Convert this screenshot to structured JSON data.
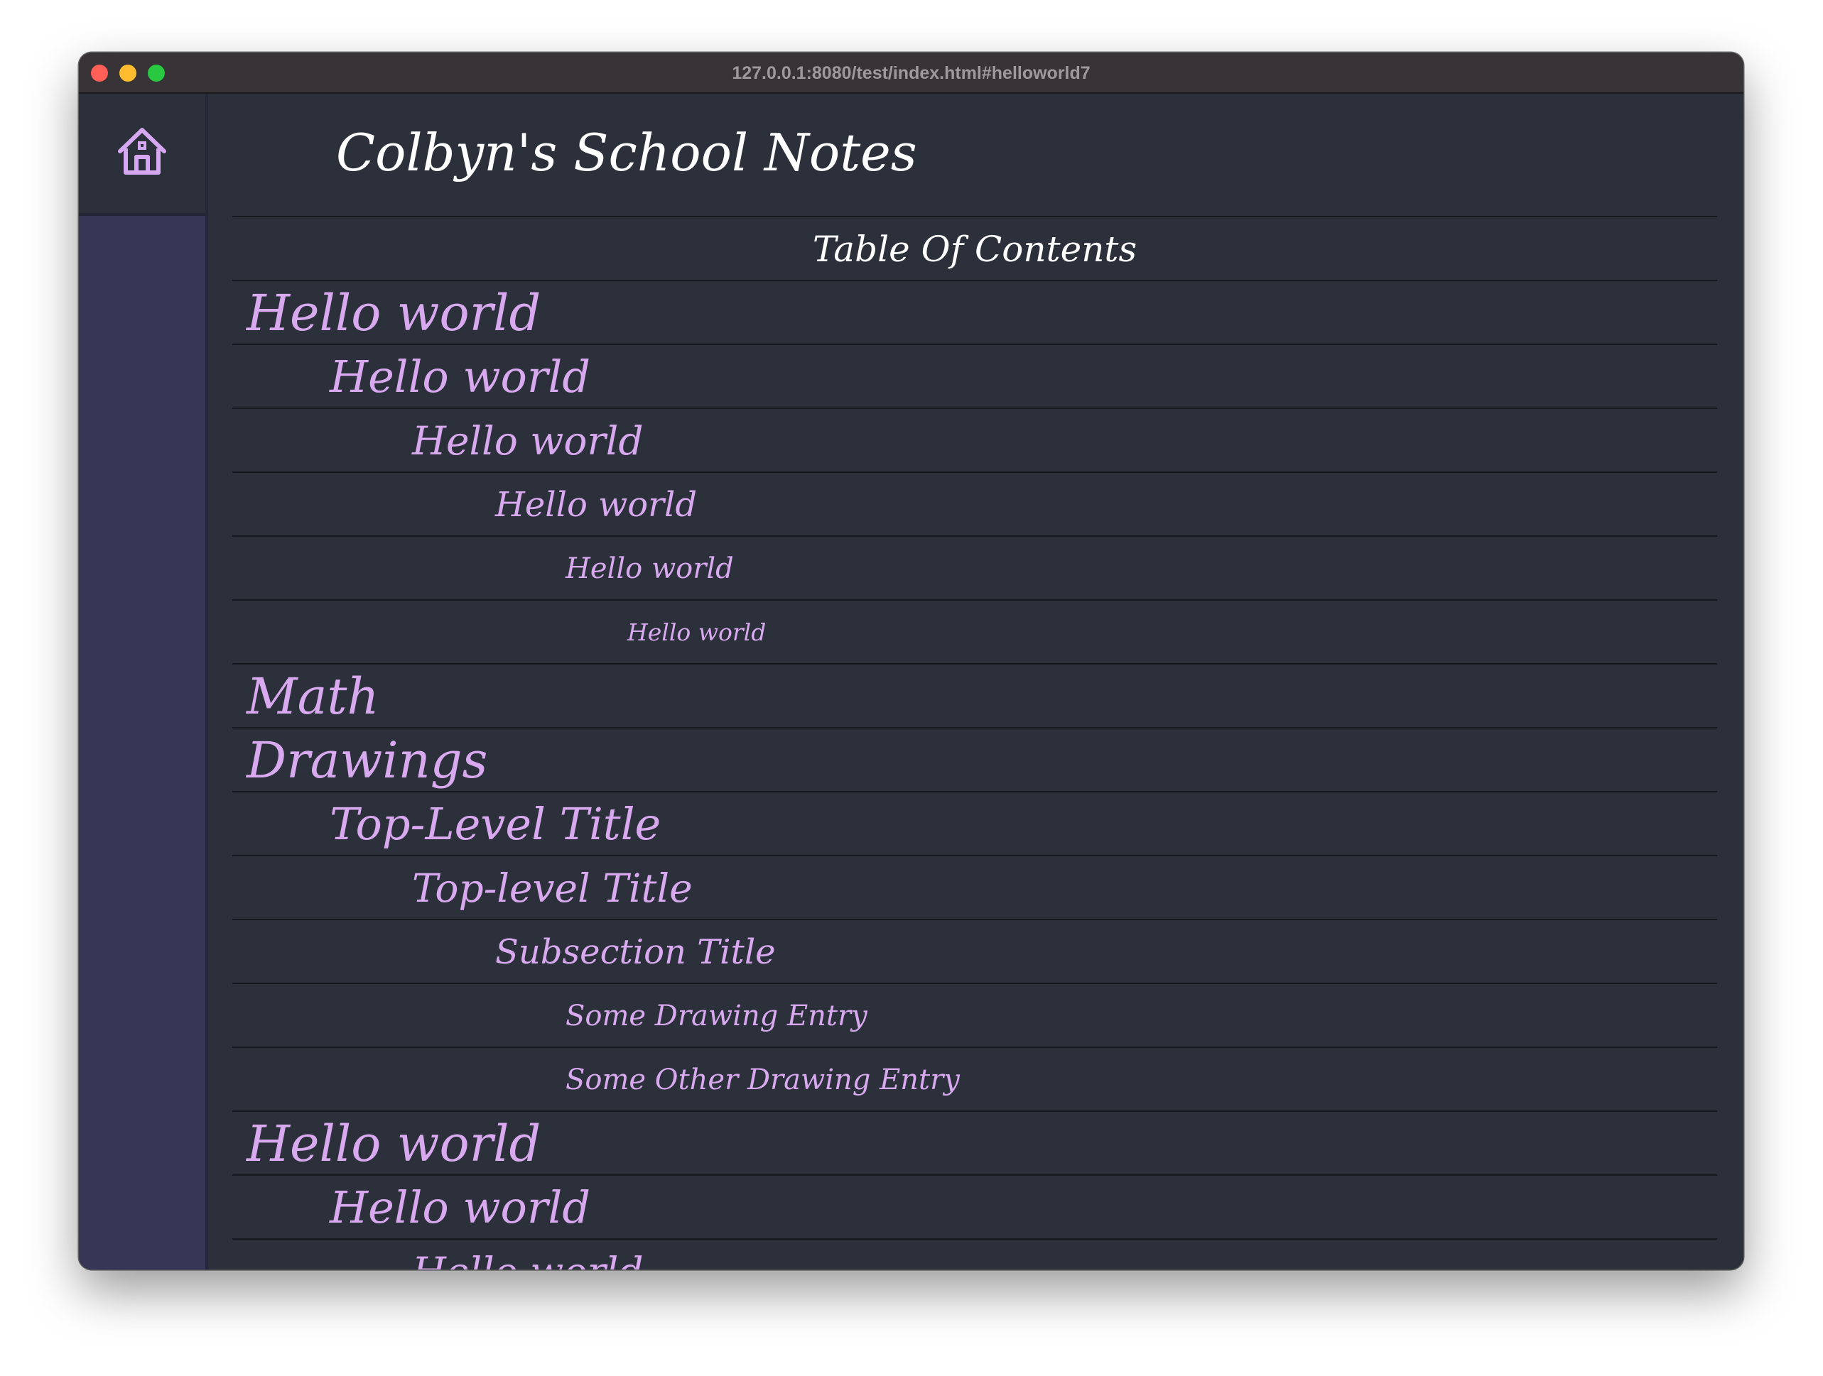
{
  "window": {
    "url": "127.0.0.1:8080/test/index.html#helloworld7"
  },
  "sidebar": {
    "home_icon": "home-icon"
  },
  "header": {
    "title": "Colbyn's School Notes"
  },
  "toc": {
    "heading": "Table Of Contents",
    "items": [
      {
        "label": "Hello world",
        "level": 1
      },
      {
        "label": "Hello world",
        "level": 2
      },
      {
        "label": "Hello world",
        "level": 3
      },
      {
        "label": "Hello world",
        "level": 4
      },
      {
        "label": "Hello world",
        "level": 5
      },
      {
        "label": "Hello world",
        "level": 6
      },
      {
        "label": "Math",
        "level": 1
      },
      {
        "label": "Drawings",
        "level": 1
      },
      {
        "label": "Top-Level Title",
        "level": 2
      },
      {
        "label": "Top-level Title",
        "level": 3
      },
      {
        "label": "Subsection Title",
        "level": 4
      },
      {
        "label": "Some Drawing Entry",
        "level": 5
      },
      {
        "label": "Some Other Drawing Entry",
        "level": 5
      },
      {
        "label": "Hello world",
        "level": 1
      },
      {
        "label": "Hello world",
        "level": 2
      },
      {
        "label": "Hello world",
        "level": 3
      }
    ]
  },
  "colors": {
    "page_background": "#2b303b",
    "sidebar_background": "#373656",
    "link_color": "#d9a9f0",
    "title_color": "#ffffff"
  }
}
